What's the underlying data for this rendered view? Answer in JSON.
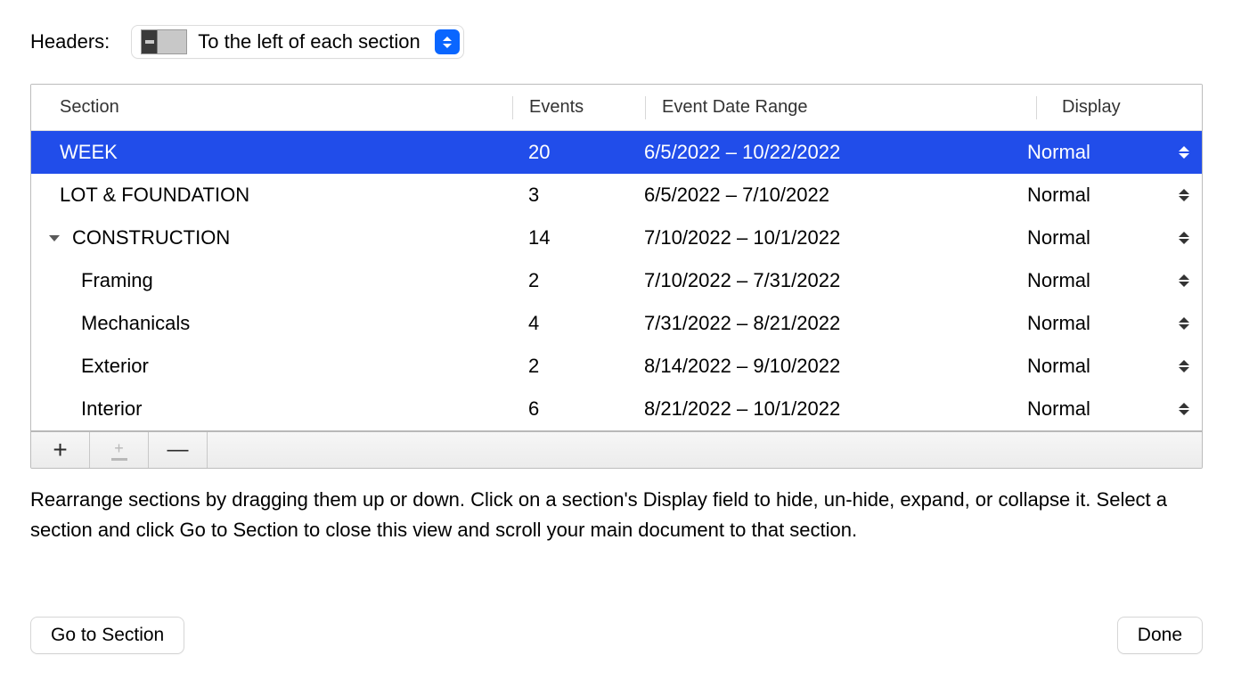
{
  "header": {
    "label": "Headers:",
    "select_value": "To the left of each section"
  },
  "columns": {
    "section": "Section",
    "events": "Events",
    "range": "Event Date Range",
    "display": "Display"
  },
  "rows": [
    {
      "name": "WEEK",
      "events": "20",
      "range": "6/5/2022 – 10/22/2022",
      "display": "Normal",
      "indent": 0,
      "selected": true,
      "hasChevron": false
    },
    {
      "name": "LOT & FOUNDATION",
      "events": "3",
      "range": "6/5/2022 – 7/10/2022",
      "display": "Normal",
      "indent": 0,
      "selected": false,
      "hasChevron": false
    },
    {
      "name": "CONSTRUCTION",
      "events": "14",
      "range": "7/10/2022 – 10/1/2022",
      "display": "Normal",
      "indent": 0,
      "selected": false,
      "hasChevron": true
    },
    {
      "name": "Framing",
      "events": "2",
      "range": "7/10/2022 – 7/31/2022",
      "display": "Normal",
      "indent": 2,
      "selected": false,
      "hasChevron": false
    },
    {
      "name": "Mechanicals",
      "events": "4",
      "range": "7/31/2022 – 8/21/2022",
      "display": "Normal",
      "indent": 2,
      "selected": false,
      "hasChevron": false
    },
    {
      "name": "Exterior",
      "events": "2",
      "range": "8/14/2022 – 9/10/2022",
      "display": "Normal",
      "indent": 2,
      "selected": false,
      "hasChevron": false
    },
    {
      "name": "Interior",
      "events": "6",
      "range": "8/21/2022 – 10/1/2022",
      "display": "Normal",
      "indent": 2,
      "selected": false,
      "hasChevron": false
    }
  ],
  "help_text": "Rearrange sections by dragging them up or down. Click on a section's Display field to hide, un-hide, expand, or collapse it. Select a section and click Go to Section to close this view and scroll your main document to that section.",
  "buttons": {
    "goto": "Go to Section",
    "done": "Done"
  },
  "toolbar": {
    "add": "+",
    "remove": "—"
  }
}
